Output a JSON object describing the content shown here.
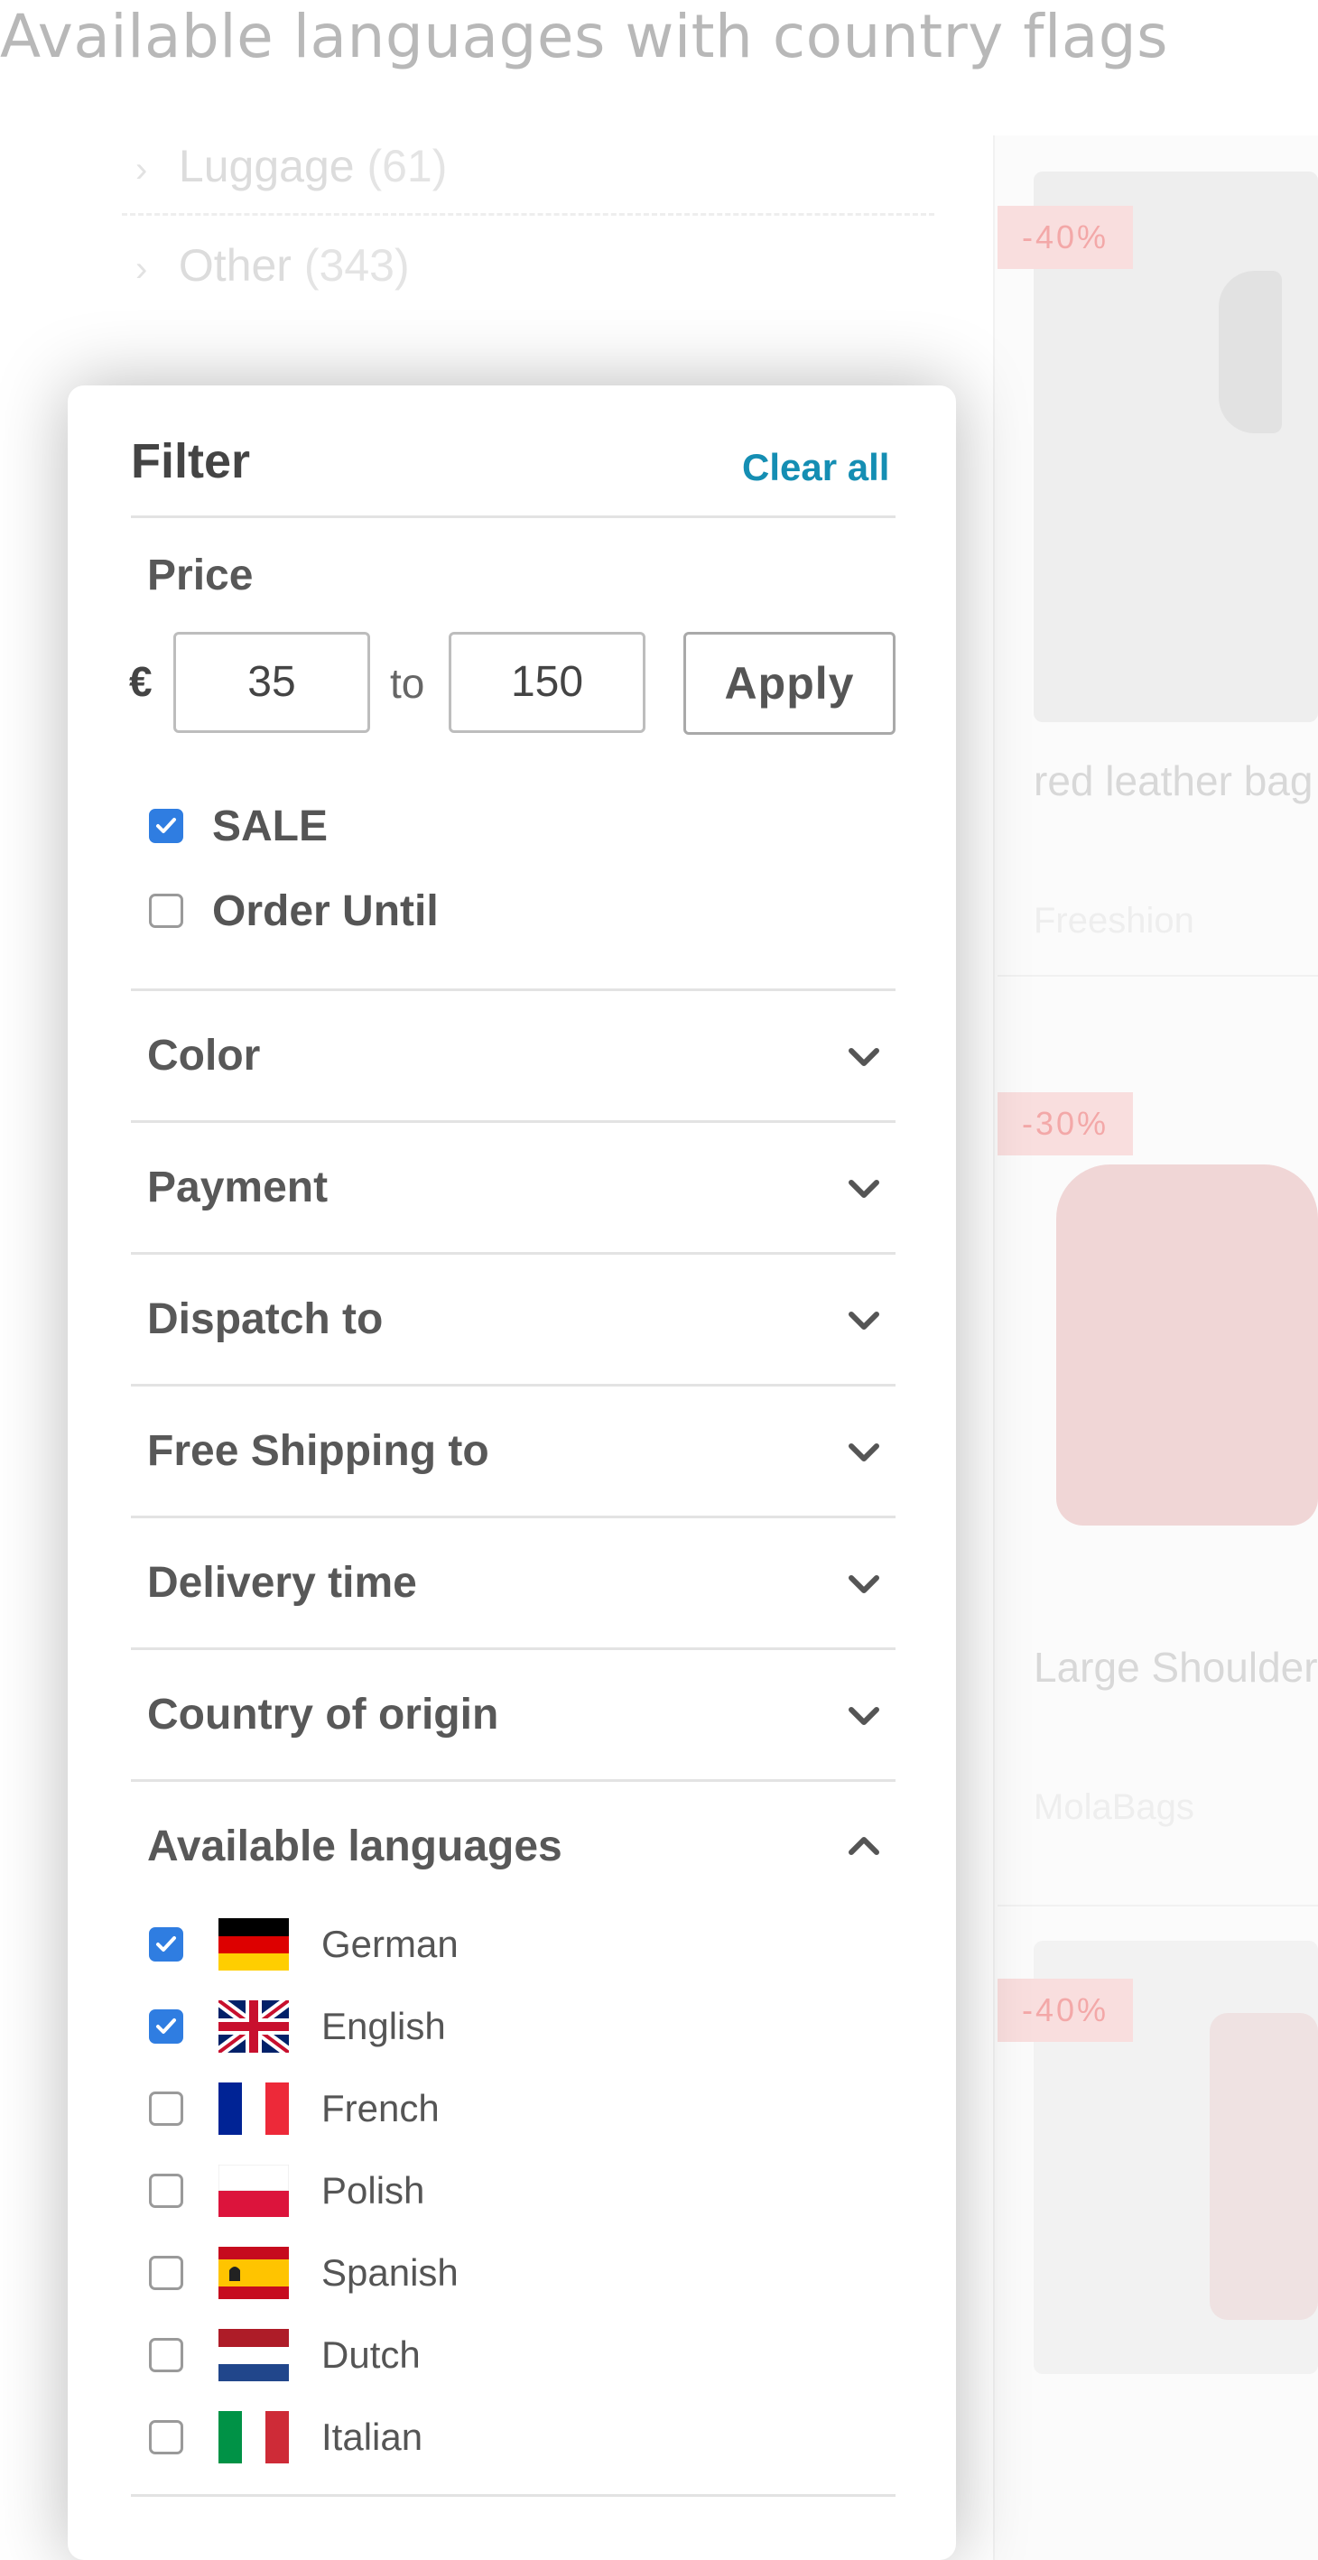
{
  "page": {
    "heading": "Available languages with country flags"
  },
  "categories": [
    {
      "name": "Luggage",
      "count": "(61)"
    },
    {
      "name": "Other",
      "count": "(343)"
    }
  ],
  "products": [
    {
      "discount": "-40%",
      "title": "red leather bag",
      "brand": "Freeshion"
    },
    {
      "discount": "-30%",
      "title": "Large Shoulder",
      "brand": "MolaBags"
    },
    {
      "discount": "-40%"
    }
  ],
  "filter": {
    "title": "Filter",
    "clear_all": "Clear all",
    "price": {
      "label": "Price",
      "currency": "€",
      "min": "35",
      "to": "to",
      "max": "150",
      "apply": "Apply"
    },
    "options": [
      {
        "label": "SALE",
        "checked": true
      },
      {
        "label": "Order Until",
        "checked": false
      }
    ],
    "sections": [
      {
        "label": "Color",
        "expanded": false
      },
      {
        "label": "Payment",
        "expanded": false
      },
      {
        "label": "Dispatch to",
        "expanded": false
      },
      {
        "label": "Free Shipping to",
        "expanded": false
      },
      {
        "label": "Delivery time",
        "expanded": false
      },
      {
        "label": "Country of origin",
        "expanded": false
      },
      {
        "label": "Available languages",
        "expanded": true
      }
    ],
    "languages": [
      {
        "name": "German",
        "flag": "germany-flag",
        "checked": true
      },
      {
        "name": "English",
        "flag": "uk-flag",
        "checked": true
      },
      {
        "name": "French",
        "flag": "france-flag",
        "checked": false
      },
      {
        "name": "Polish",
        "flag": "poland-flag",
        "checked": false
      },
      {
        "name": "Spanish",
        "flag": "spain-flag",
        "checked": false
      },
      {
        "name": "Dutch",
        "flag": "netherlands-flag",
        "checked": false
      },
      {
        "name": "Italian",
        "flag": "italy-flag",
        "checked": false
      }
    ]
  },
  "colors": {
    "accent": "#158eb3",
    "checkbox": "#2f7de1",
    "badge": "#f9dede"
  }
}
